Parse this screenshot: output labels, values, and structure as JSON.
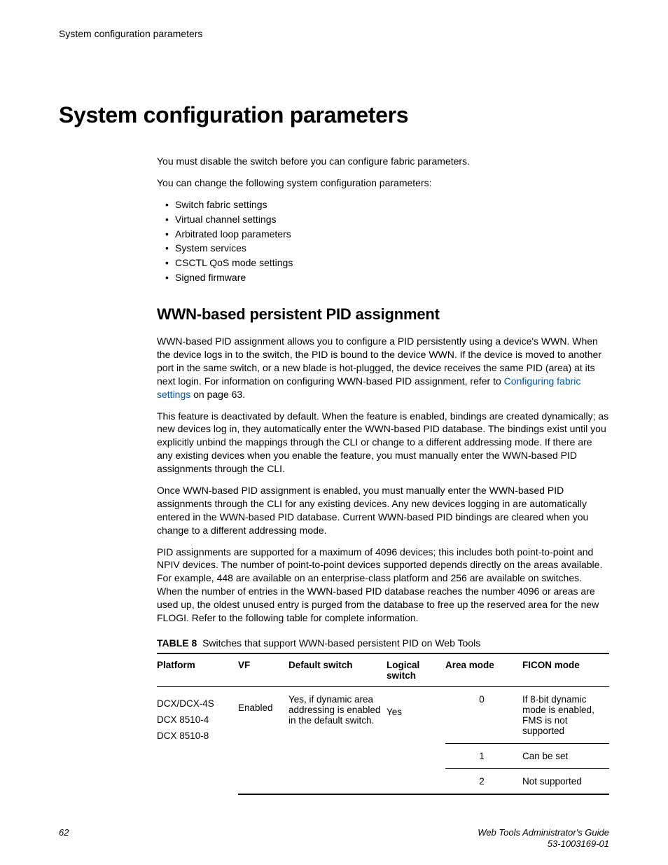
{
  "header": {
    "running": "System configuration parameters"
  },
  "h1": "System configuration parameters",
  "intro": {
    "p1": "You must disable the switch before you can configure fabric parameters.",
    "p2": "You can change the following system configuration parameters:",
    "bullets": [
      "Switch fabric settings",
      "Virtual channel settings",
      "Arbitrated loop parameters",
      "System services",
      "CSCTL QoS mode settings",
      "Signed firmware"
    ]
  },
  "h2": "WWN-based persistent PID assignment",
  "wwn": {
    "p1a": "WWN-based PID assignment allows you to configure a PID persistently using a device's WWN. When the device logs in to the switch, the PID is bound to the device WWN. If the device is moved to another port in the same switch, or a new blade is hot-plugged, the device receives the same PID (area) at its next login. For information on configuring WWN-based PID assignment, refer to ",
    "link": "Configuring fabric settings",
    "p1b": " on page 63.",
    "p2": "This feature is deactivated by default. When the feature is enabled, bindings are created dynamically; as new devices log in, they automatically enter the WWN-based PID database. The bindings exist until you explicitly unbind the mappings through the CLI or change to a different addressing mode. If there are any existing devices when you enable the feature, you must manually enter the WWN-based PID assignments through the CLI.",
    "p3": "Once WWN-based PID assignment is enabled, you must manually enter the WWN-based PID assignments through the CLI for any existing devices. Any new devices logging in are automatically entered in the WWN-based PID database. Current WWN-based PID bindings are cleared when you change to a different addressing mode.",
    "p4": "PID assignments are supported for a maximum of 4096 devices; this includes both point-to-point and NPIV devices. The number of point-to-point devices supported depends directly on the areas available. For example, 448 are available on an enterprise-class platform and 256 are available on switches. When the number of entries in the WWN-based PID database reaches the number 4096 or areas are used up, the oldest unused entry is purged from the database to free up the reserved area for the new FLOGI. Refer to the following table for complete information."
  },
  "table": {
    "label": "TABLE 8",
    "caption": "Switches that support WWN-based persistent PID on Web Tools",
    "headers": {
      "platform": "Platform",
      "vf": "VF",
      "default": "Default switch",
      "logical": "Logical switch",
      "area": "Area mode",
      "ficon": "FICON mode"
    },
    "rows": {
      "platform_l1": "DCX/DCX-4S",
      "platform_l2": "DCX 8510-4",
      "platform_l3": "DCX 8510-8",
      "vf": "Enabled",
      "default": "Yes, if dynamic area addressing is enabled in the default switch.",
      "logical": "Yes",
      "r1_area": "0",
      "r1_ficon": "If 8-bit dynamic mode is enabled, FMS is not supported",
      "r2_area": "1",
      "r2_ficon": "Can be set",
      "r3_area": "2",
      "r3_ficon": "Not supported"
    }
  },
  "footer": {
    "page": "62",
    "doc_title": "Web Tools Administrator's Guide",
    "doc_num": "53-1003169-01"
  },
  "chart_data": {
    "type": "table",
    "title": "Switches that support WWN-based persistent PID on Web Tools",
    "columns": [
      "Platform",
      "VF",
      "Default switch",
      "Logical switch",
      "Area mode",
      "FICON mode"
    ],
    "rows": [
      [
        "DCX/DCX-4S; DCX 8510-4; DCX 8510-8",
        "Enabled",
        "Yes, if dynamic area addressing is enabled in the default switch.",
        "Yes",
        0,
        "If 8-bit dynamic mode is enabled, FMS is not supported"
      ],
      [
        "",
        "",
        "",
        "",
        1,
        "Can be set"
      ],
      [
        "",
        "",
        "",
        "",
        2,
        "Not supported"
      ]
    ]
  }
}
